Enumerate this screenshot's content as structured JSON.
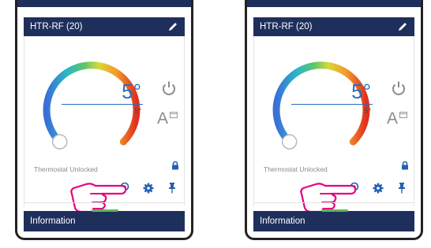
{
  "panels": [
    {
      "device_title": "HTR-RF (20)",
      "setpoint": "5°",
      "current_temp": "5°",
      "lock_status": "Thermostat Unlocked",
      "auto_mode_label": "A",
      "info_label": "Information"
    },
    {
      "device_title": "HTR-RF (20)",
      "setpoint": "5°",
      "current_temp": "5°",
      "lock_status": "Thermostat Unlocked",
      "auto_mode_label": "A",
      "info_label": "Information"
    }
  ],
  "colors": {
    "header_bg": "#1f2f5c",
    "temp_text": "#2a6fbf",
    "icon_blue": "#2460b0",
    "icon_grey": "#8c8c8c",
    "hand_pink": "#e6007e"
  },
  "icons": [
    "pencil-icon",
    "power-icon",
    "auto-mode-icon",
    "lock-icon",
    "search-icon",
    "gear-icon",
    "pin-icon",
    "pointing-hand-icon"
  ]
}
